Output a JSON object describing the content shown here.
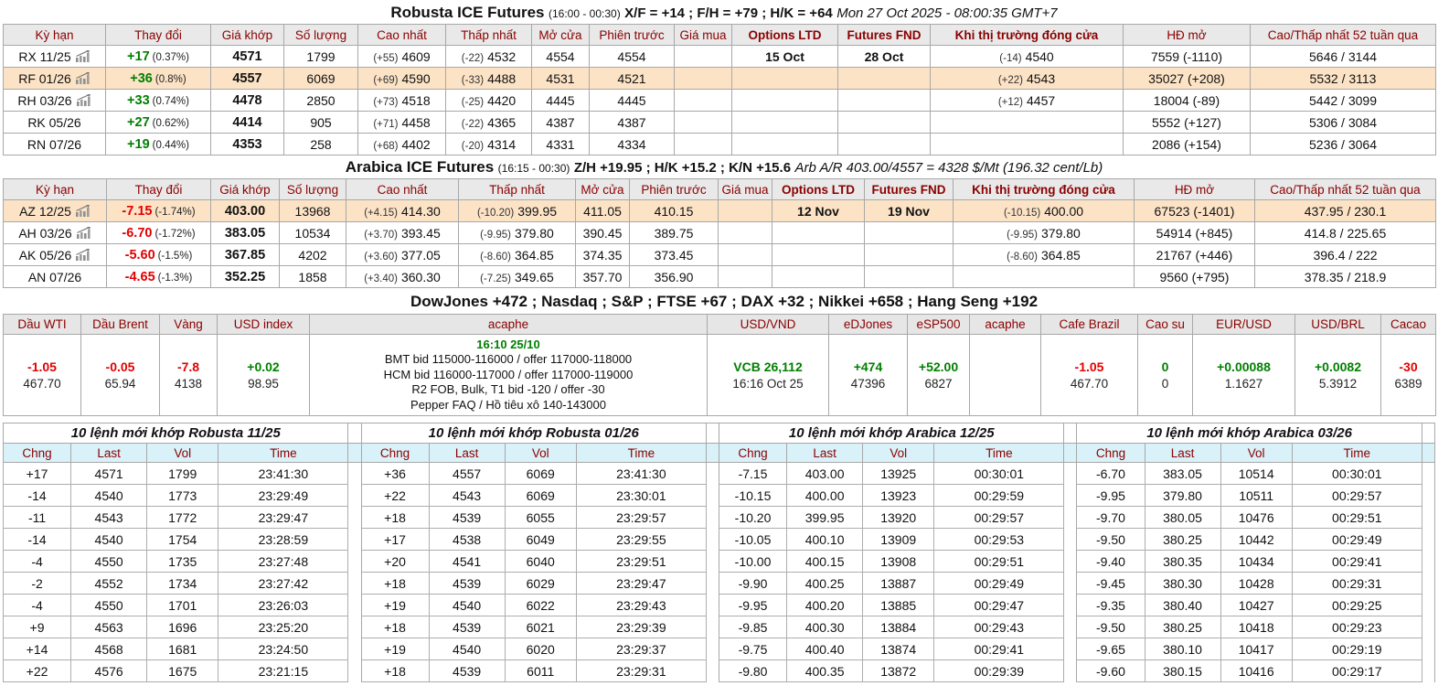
{
  "robusta": {
    "title": "Robusta ICE Futures",
    "session": "(16:00 - 00:30)",
    "spreads": "X/F = +14 ; F/H = +79 ; H/K = +64",
    "datetime": "Mon 27 Oct 2025 - 08:00:35 GMT+7",
    "rows": [
      {
        "name": "RX 11/25",
        "icon": true,
        "hl": false,
        "chg": "+17",
        "dir": "up",
        "pct": "(0.37%)",
        "last": "4571",
        "vol": "1799",
        "hi_d": "(+55)",
        "hi": "4609",
        "lo_d": "(-22)",
        "lo": "4532",
        "open": "4554",
        "prev": "4554",
        "buy": "",
        "opt": "15 Oct",
        "fnd": "28 Oct",
        "cls_d": "(-14)",
        "cls": "4540",
        "oi": "7559 (-1110)",
        "r52": "5646 / 3144"
      },
      {
        "name": "RF 01/26",
        "icon": true,
        "hl": true,
        "chg": "+36",
        "dir": "up",
        "pct": "(0.8%)",
        "last": "4557",
        "vol": "6069",
        "hi_d": "(+69)",
        "hi": "4590",
        "lo_d": "(-33)",
        "lo": "4488",
        "open": "4531",
        "prev": "4521",
        "buy": "",
        "opt": "",
        "fnd": "",
        "cls_d": "(+22)",
        "cls": "4543",
        "oi": "35027 (+208)",
        "r52": "5532 / 3113"
      },
      {
        "name": "RH 03/26",
        "icon": true,
        "hl": false,
        "chg": "+33",
        "dir": "up",
        "pct": "(0.74%)",
        "last": "4478",
        "vol": "2850",
        "hi_d": "(+73)",
        "hi": "4518",
        "lo_d": "(-25)",
        "lo": "4420",
        "open": "4445",
        "prev": "4445",
        "buy": "",
        "opt": "",
        "fnd": "",
        "cls_d": "(+12)",
        "cls": "4457",
        "oi": "18004 (-89)",
        "r52": "5442 / 3099"
      },
      {
        "name": "RK 05/26",
        "icon": false,
        "hl": false,
        "chg": "+27",
        "dir": "up",
        "pct": "(0.62%)",
        "last": "4414",
        "vol": "905",
        "hi_d": "(+71)",
        "hi": "4458",
        "lo_d": "(-22)",
        "lo": "4365",
        "open": "4387",
        "prev": "4387",
        "buy": "",
        "opt": "",
        "fnd": "",
        "cls_d": "",
        "cls": "",
        "oi": "5552 (+127)",
        "r52": "5306 / 3084"
      },
      {
        "name": "RN 07/26",
        "icon": false,
        "hl": false,
        "chg": "+19",
        "dir": "up",
        "pct": "(0.44%)",
        "last": "4353",
        "vol": "258",
        "hi_d": "(+68)",
        "hi": "4402",
        "lo_d": "(-20)",
        "lo": "4314",
        "open": "4331",
        "prev": "4334",
        "buy": "",
        "opt": "",
        "fnd": "",
        "cls_d": "",
        "cls": "",
        "oi": "2086 (+154)",
        "r52": "5236 / 3064"
      }
    ]
  },
  "arabica": {
    "title": "Arabica ICE Futures",
    "session": "(16:15 - 00:30)",
    "spreads": "Z/H +19.95 ; H/K +15.2 ; K/N +15.6",
    "note": "Arb A/R 403.00/4557 = 4328 $/Mt (196.32 cent/Lb)",
    "rows": [
      {
        "name": "AZ 12/25",
        "icon": true,
        "hl": true,
        "chg": "-7.15",
        "dir": "down",
        "pct": "(-1.74%)",
        "last": "403.00",
        "vol": "13968",
        "hi_d": "(+4.15)",
        "hi": "414.30",
        "lo_d": "(-10.20)",
        "lo": "399.95",
        "open": "411.05",
        "prev": "410.15",
        "buy": "",
        "opt": "12 Nov",
        "fnd": "19 Nov",
        "cls_d": "(-10.15)",
        "cls": "400.00",
        "oi": "67523 (-1401)",
        "r52": "437.95 / 230.1"
      },
      {
        "name": "AH 03/26",
        "icon": true,
        "hl": false,
        "chg": "-6.70",
        "dir": "down",
        "pct": "(-1.72%)",
        "last": "383.05",
        "vol": "10534",
        "hi_d": "(+3.70)",
        "hi": "393.45",
        "lo_d": "(-9.95)",
        "lo": "379.80",
        "open": "390.45",
        "prev": "389.75",
        "buy": "",
        "opt": "",
        "fnd": "",
        "cls_d": "(-9.95)",
        "cls": "379.80",
        "oi": "54914 (+845)",
        "r52": "414.8 / 225.65"
      },
      {
        "name": "AK 05/26",
        "icon": true,
        "hl": false,
        "chg": "-5.60",
        "dir": "down",
        "pct": "(-1.5%)",
        "last": "367.85",
        "vol": "4202",
        "hi_d": "(+3.60)",
        "hi": "377.05",
        "lo_d": "(-8.60)",
        "lo": "364.85",
        "open": "374.35",
        "prev": "373.45",
        "buy": "",
        "opt": "",
        "fnd": "",
        "cls_d": "(-8.60)",
        "cls": "364.85",
        "oi": "21767 (+446)",
        "r52": "396.4 / 222"
      },
      {
        "name": "AN 07/26",
        "icon": false,
        "hl": false,
        "chg": "-4.65",
        "dir": "down",
        "pct": "(-1.3%)",
        "last": "352.25",
        "vol": "1858",
        "hi_d": "(+3.40)",
        "hi": "360.30",
        "lo_d": "(-7.25)",
        "lo": "349.65",
        "open": "357.70",
        "prev": "356.90",
        "buy": "",
        "opt": "",
        "fnd": "",
        "cls_d": "",
        "cls": "",
        "oi": "9560 (+795)",
        "r52": "378.35 / 218.9"
      }
    ]
  },
  "futures_columns": [
    {
      "label": "Kỳ hạn"
    },
    {
      "label": "Thay đổi"
    },
    {
      "label": "Giá khớp"
    },
    {
      "label": "Số lượng"
    },
    {
      "label": "Cao nhất"
    },
    {
      "label": "Thấp nhất"
    },
    {
      "label": "Mở cửa"
    },
    {
      "label": "Phiên trước"
    },
    {
      "label": "Giá mua"
    },
    {
      "label": "Options LTD",
      "bold": true
    },
    {
      "label": "Futures FND",
      "bold": true
    },
    {
      "label": "Khi thị trường đóng cửa",
      "bold": true
    },
    {
      "label": "HĐ mở"
    },
    {
      "label": "Cao/Thấp nhất 52 tuần qua"
    }
  ],
  "indices_line": "DowJones +472 ; Nasdaq ; S&P ; FTSE +67 ; DAX +32 ; Nikkei +658 ; Hang Seng +192",
  "market": {
    "cols": [
      {
        "label": "Dầu WTI",
        "top": "-1.05",
        "dir": "down",
        "bottom": "467.70"
      },
      {
        "label": "Dầu Brent",
        "top": "-0.05",
        "dir": "down",
        "bottom": "65.94"
      },
      {
        "label": "Vàng",
        "top": "-7.8",
        "dir": "down",
        "bottom": "4138"
      },
      {
        "label": "USD index",
        "top": "+0.02",
        "dir": "up",
        "bottom": "98.95"
      },
      {
        "label": "acaphe",
        "info": true,
        "top": "",
        "bottom": ""
      },
      {
        "label": "USD/VND",
        "top": "VCB 26,112",
        "dir": "up",
        "bottom": "16:16 Oct 25"
      },
      {
        "label": "eDJones",
        "top": "+474",
        "dir": "up",
        "bottom": "47396"
      },
      {
        "label": "eSP500",
        "top": "+52.00",
        "dir": "up",
        "bottom": "6827"
      },
      {
        "label": "acaphe",
        "top": "",
        "bottom": ""
      },
      {
        "label": "Cafe Brazil",
        "top": "-1.05",
        "dir": "down",
        "bottom": "467.70"
      },
      {
        "label": "Cao su",
        "top": "0",
        "dir": "up",
        "bottom": "0"
      },
      {
        "label": "EUR/USD",
        "top": "+0.00088",
        "dir": "up",
        "bottom": "1.1627"
      },
      {
        "label": "USD/BRL",
        "top": "+0.0082",
        "dir": "up",
        "bottom": "5.3912"
      },
      {
        "label": "Cacao",
        "top": "-30",
        "dir": "down",
        "bottom": "6389"
      }
    ],
    "acaphe": {
      "time": "16:10 25/10",
      "lines": [
        "BMT bid 115000-116000 / offer 117000-118000",
        "HCM bid 116000-117000 / offer 117000-119000",
        "R2 FOB, Bulk, T1 bid -120 / offer -30",
        "Pepper FAQ / Hồ tiêu xô 140-143000"
      ]
    }
  },
  "orders": {
    "columns": [
      "Chng",
      "Last",
      "Vol",
      "Time"
    ],
    "tables": [
      {
        "title": "10 lệnh mới khớp Robusta 11/25",
        "rows": [
          [
            "+17",
            "4571",
            "1799",
            "23:41:30"
          ],
          [
            "-14",
            "4540",
            "1773",
            "23:29:49"
          ],
          [
            "-11",
            "4543",
            "1772",
            "23:29:47"
          ],
          [
            "-14",
            "4540",
            "1754",
            "23:28:59"
          ],
          [
            "-4",
            "4550",
            "1735",
            "23:27:48"
          ],
          [
            "-2",
            "4552",
            "1734",
            "23:27:42"
          ],
          [
            "-4",
            "4550",
            "1701",
            "23:26:03"
          ],
          [
            "+9",
            "4563",
            "1696",
            "23:25:20"
          ],
          [
            "+14",
            "4568",
            "1681",
            "23:24:50"
          ],
          [
            "+22",
            "4576",
            "1675",
            "23:21:15"
          ]
        ]
      },
      {
        "title": "10 lệnh mới khớp Robusta 01/26",
        "rows": [
          [
            "+36",
            "4557",
            "6069",
            "23:41:30"
          ],
          [
            "+22",
            "4543",
            "6069",
            "23:30:01"
          ],
          [
            "+18",
            "4539",
            "6055",
            "23:29:57"
          ],
          [
            "+17",
            "4538",
            "6049",
            "23:29:55"
          ],
          [
            "+20",
            "4541",
            "6040",
            "23:29:51"
          ],
          [
            "+18",
            "4539",
            "6029",
            "23:29:47"
          ],
          [
            "+19",
            "4540",
            "6022",
            "23:29:43"
          ],
          [
            "+18",
            "4539",
            "6021",
            "23:29:39"
          ],
          [
            "+19",
            "4540",
            "6020",
            "23:29:37"
          ],
          [
            "+18",
            "4539",
            "6011",
            "23:29:31"
          ]
        ]
      },
      {
        "title": "10 lệnh mới khớp Arabica 12/25",
        "rows": [
          [
            "-7.15",
            "403.00",
            "13925",
            "00:30:01"
          ],
          [
            "-10.15",
            "400.00",
            "13923",
            "00:29:59"
          ],
          [
            "-10.20",
            "399.95",
            "13920",
            "00:29:57"
          ],
          [
            "-10.05",
            "400.10",
            "13909",
            "00:29:53"
          ],
          [
            "-10.00",
            "400.15",
            "13908",
            "00:29:51"
          ],
          [
            "-9.90",
            "400.25",
            "13887",
            "00:29:49"
          ],
          [
            "-9.95",
            "400.20",
            "13885",
            "00:29:47"
          ],
          [
            "-9.85",
            "400.30",
            "13884",
            "00:29:43"
          ],
          [
            "-9.75",
            "400.40",
            "13874",
            "00:29:41"
          ],
          [
            "-9.80",
            "400.35",
            "13872",
            "00:29:39"
          ]
        ]
      },
      {
        "title": "10 lệnh mới khớp Arabica 03/26",
        "rows": [
          [
            "-6.70",
            "383.05",
            "10514",
            "00:30:01"
          ],
          [
            "-9.95",
            "379.80",
            "10511",
            "00:29:57"
          ],
          [
            "-9.70",
            "380.05",
            "10476",
            "00:29:51"
          ],
          [
            "-9.50",
            "380.25",
            "10442",
            "00:29:49"
          ],
          [
            "-9.40",
            "380.35",
            "10434",
            "00:29:41"
          ],
          [
            "-9.45",
            "380.30",
            "10428",
            "00:29:31"
          ],
          [
            "-9.35",
            "380.40",
            "10427",
            "00:29:25"
          ],
          [
            "-9.50",
            "380.25",
            "10418",
            "00:29:23"
          ],
          [
            "-9.65",
            "380.10",
            "10417",
            "00:29:19"
          ],
          [
            "-9.60",
            "380.15",
            "10416",
            "00:29:17"
          ]
        ]
      }
    ]
  },
  "colors": {
    "header_text": "#8b0000",
    "up": "#008000",
    "down": "#e30000",
    "highlight_row": "#fce3c6",
    "futures_header_bg": "#e9e9e9",
    "orders_header_bg": "#d9f1f8"
  }
}
